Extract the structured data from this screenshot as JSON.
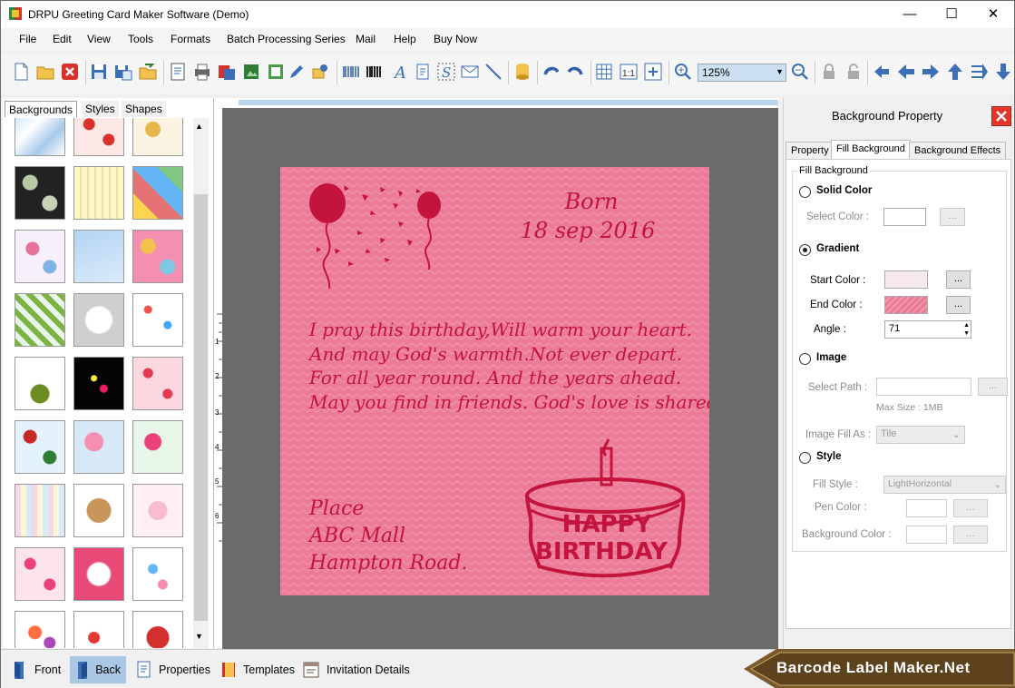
{
  "window": {
    "title": "DRPU Greeting Card Maker Software (Demo)",
    "minimize": "—",
    "maximize": "☐",
    "close": "✕"
  },
  "menu": [
    "File",
    "Edit",
    "View",
    "Tools",
    "Formats",
    "Batch Processing Series",
    "Mail",
    "Help",
    "Buy Now"
  ],
  "toolbar": {
    "zoom_value": "125%"
  },
  "left_panel": {
    "tabs": [
      "Backgrounds",
      "Styles",
      "Shapes"
    ],
    "active_tab": "Backgrounds"
  },
  "card": {
    "born_label": "Born",
    "born_date": "18 sep  2016",
    "verse": [
      "I pray this birthday,Will warm your heart.",
      "And may God's warmth.Not ever depart.",
      "For all year round. And the years ahead.",
      "May you find in friends. God's love is shared."
    ],
    "place": [
      "Place",
      "ABC Mall",
      "Hampton Road."
    ],
    "cake_text": [
      "HAPPY",
      "BIRTHDAY"
    ]
  },
  "ruler_numbers": [
    "1",
    "2",
    "3",
    "4",
    "5",
    "6"
  ],
  "right_panel": {
    "title": "Background Property",
    "tabs": [
      "Property",
      "Fill Background",
      "Background Effects"
    ],
    "active_tab": "Fill Background",
    "group_label": "Fill Background",
    "solid_color": "Solid Color",
    "select_color": "Select Color :",
    "gradient": "Gradient",
    "start_color": "Start Color :",
    "end_color": "End Color :",
    "angle": "Angle :",
    "angle_value": "71",
    "image": "Image",
    "select_path": "Select Path :",
    "max_size": "Max Size : 1MB",
    "image_fill_as": "Image Fill As :",
    "image_fill_value": "Tile",
    "style": "Style",
    "fill_style": "Fill Style :",
    "fill_style_value": "LightHorizontal",
    "pen_color": "Pen Color :",
    "background_color": "Background Color :",
    "browse": "...",
    "selected_option": "Gradient",
    "start_color_hex": "#f5e9ee",
    "end_color_hex": "#e87a96"
  },
  "bottom": {
    "buttons": [
      "Front",
      "Back",
      "Properties",
      "Templates",
      "Invitation Details"
    ],
    "active": "Back"
  },
  "watermark": "Barcode Label Maker.Net",
  "colors": {
    "card_bg": "#ec7b99",
    "card_text": "#c2143c",
    "canvas_bg": "#6b6b6b",
    "accent": "#aac8e6"
  }
}
